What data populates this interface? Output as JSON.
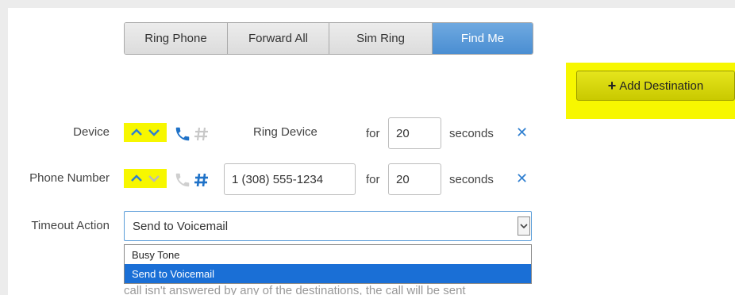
{
  "modes": [
    {
      "label": "Ring Phone",
      "active": false
    },
    {
      "label": "Forward All",
      "active": false
    },
    {
      "label": "Sim Ring",
      "active": false
    },
    {
      "label": "Find Me",
      "active": true
    }
  ],
  "add_destination": {
    "label": "Add Destination"
  },
  "device_row": {
    "label": "Device",
    "ring_text": "Ring Device",
    "for_label": "for",
    "seconds_value": "20",
    "seconds_label": "seconds"
  },
  "phone_row": {
    "label": "Phone Number",
    "phone_value": "1 (308) 555-1234",
    "for_label": "for",
    "seconds_value": "20",
    "seconds_label": "seconds"
  },
  "timeout": {
    "label": "Timeout Action",
    "selected": "Send to Voicemail",
    "options": [
      "Busy Tone",
      "Send to Voicemail"
    ]
  },
  "footer_text": "call isn't answered by any of the destinations, the call will be sent",
  "colors": {
    "accent_blue": "#2f7fd0",
    "highlight_yellow": "#f7f700",
    "active_mode": "#4a8ed2"
  },
  "icons": {
    "move_up": "chevron-up-icon",
    "move_down": "chevron-down-icon",
    "device_type": "phone-icon",
    "number_type": "hash-icon",
    "remove": "close-icon"
  }
}
